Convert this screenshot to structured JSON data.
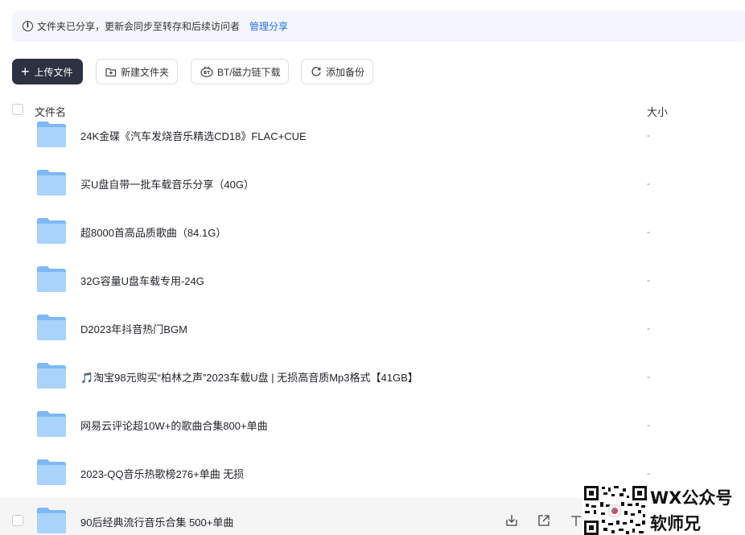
{
  "notice": {
    "text": "文件夹已分享，更新会同步至转存和后续访问者",
    "link": "管理分享"
  },
  "toolbar": {
    "upload_label": "上传文件",
    "new_folder_label": "新建文件夹",
    "bt_label": "BT/磁力链下载",
    "backup_label": "添加备份"
  },
  "table": {
    "col_name": "文件名",
    "col_size": "大小"
  },
  "files": [
    {
      "name": "24K金碟《汽车发烧音乐精选CD18》FLAC+CUE",
      "size": "-"
    },
    {
      "name": "买U盘自带一批车载音乐分享（40G）",
      "size": "-"
    },
    {
      "name": "超8000首高品质歌曲（84.1G）",
      "size": "-"
    },
    {
      "name": "32G容量U盘车载专用-24G",
      "size": "-"
    },
    {
      "name": "D2023年抖音热门BGM",
      "size": "-"
    },
    {
      "name": "🎵淘宝98元购买“柏林之声”2023车载U盘 | 无损高音质Mp3格式【41GB】",
      "size": "-"
    },
    {
      "name": "网易云评论超10W+的歌曲合集800+单曲",
      "size": "-"
    },
    {
      "name": "2023-QQ音乐热歌榜276+单曲 无损",
      "size": "-"
    },
    {
      "name": "90后经典流行音乐合集 500+单曲",
      "size": ""
    }
  ],
  "watermark": {
    "line1": "WX公众号",
    "line2": "软师兄"
  },
  "colors": {
    "primary_button": "#2d3142",
    "link": "#2b6ff0",
    "folder": "#8dc3f7",
    "notice_bg": "#f3f7fd"
  }
}
